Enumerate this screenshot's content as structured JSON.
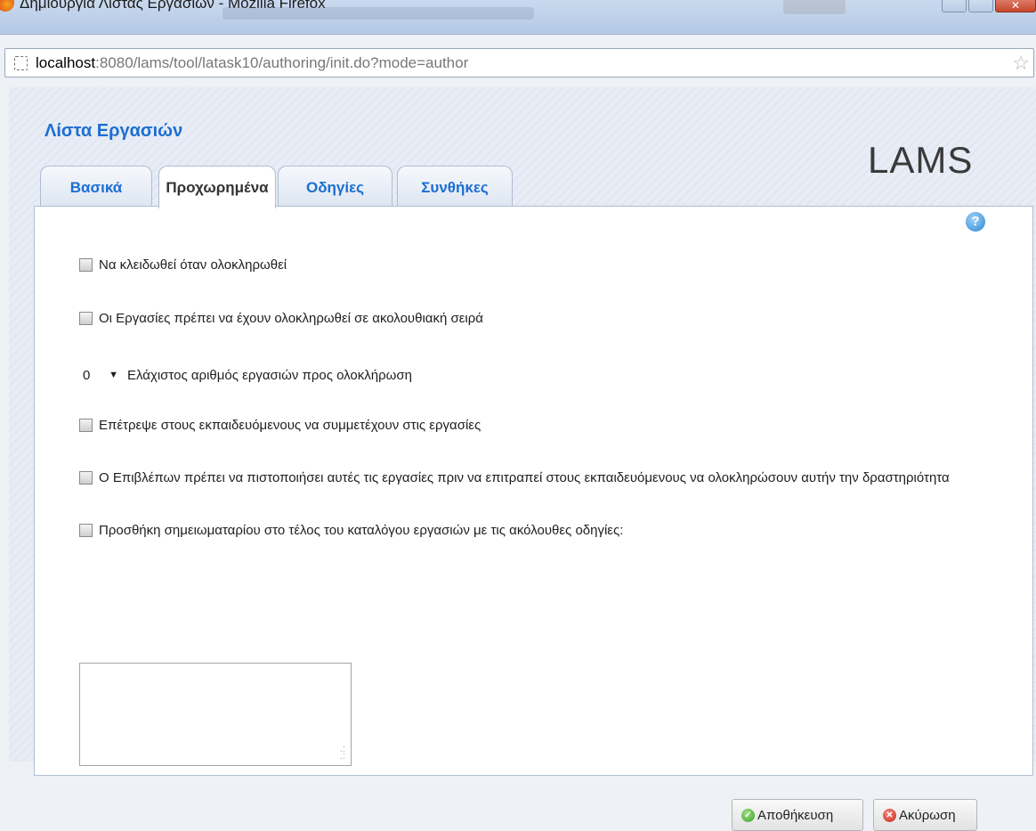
{
  "window": {
    "title": "Δημιουργία Λίστας Εργασιών - Mozilla Firefox"
  },
  "browser": {
    "url_host": "localhost",
    "url_path": ":8080/lams/tool/latask10/authoring/init.do?mode=author"
  },
  "app": {
    "title": "Λίστα Εργασιών",
    "logo": "LAMS"
  },
  "tabs": [
    {
      "label": "Βασικά"
    },
    {
      "label": "Προχωρημένα"
    },
    {
      "label": "Οδηγίες"
    },
    {
      "label": "Συνθήκες"
    }
  ],
  "active_tab": "Προχωρημένα",
  "options": {
    "lock_when_finished": "Να κλειδωθεί όταν ολοκληρωθεί",
    "sequential_order": "Οι Εργασίες πρέπει να έχουν ολοκληρωθεί σε ακολουθιακή σειρά",
    "min_tasks_value": "0",
    "min_tasks_label": "Ελάχιστος αριθμός εργασιών προς ολοκλήρωση",
    "allow_contribution": "Επέτρεψε στους εκπαιδευόμενους να συμμετέχουν στις εργασίες",
    "monitor_verify": "Ο Επιβλέπων πρέπει να πιστοποιήσει αυτές τις εργασίες πριν να επιτραπεί στους εκπαιδευόμενους να ολοκληρώσουν αυτήν την δραστηριότητα",
    "add_notebook": "Προσθήκη σημειωματαρίου στο τέλος του καταλόγου εργασιών με τις ακόλουθες οδηγίες:"
  },
  "notebook_text": "",
  "buttons": {
    "save": "Αποθήκευση",
    "cancel": "Ακύρωση"
  },
  "help_icon": "?"
}
